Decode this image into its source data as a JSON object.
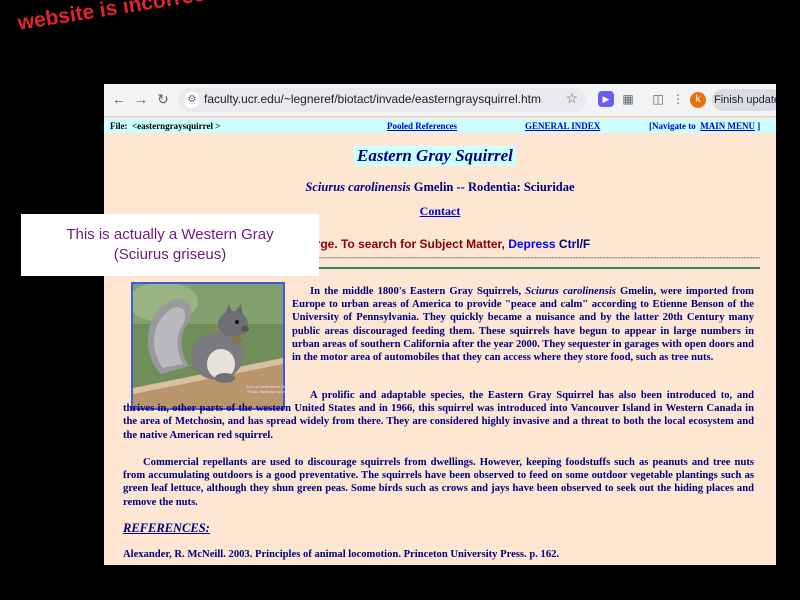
{
  "annotations": {
    "top_note": "website is incorrect",
    "overlay_line1": "This is actually a Western Gray",
    "overlay_line2": "(Sciurus griseus)"
  },
  "browser": {
    "url": "faculty.ucr.edu/~legneref/biotact/invade/easterngraysquirrel.htm",
    "profile_initial": "k",
    "update_button": "Finish update",
    "icons": [
      "back-arrow-icon",
      "forward-arrow-icon",
      "reload-icon",
      "site-settings-icon",
      "bookmark-star-icon",
      "extension-icon",
      "puzzle-icon",
      "tab-search-icon",
      "profile-avatar-icon"
    ]
  },
  "page": {
    "topbar": {
      "file_label": "File:",
      "file_name": "<easterngraysquirrel >",
      "pooled_refs": "Pooled References",
      "general_index": "GENERAL INDEX",
      "navigate_prefix": "[Navigate to",
      "main_menu": "MAIN MENU",
      "navigate_suffix": "]"
    },
    "title": "Eastern Gray Squirrel",
    "sci_name": "Sciurus carolinensis",
    "sci_rest": " Gmelin -- Rodentia:  Sciuridae",
    "contact": "Contact",
    "search_text": "arge.  To search for Subject Matter,",
    "search_depress": "Depress",
    "search_key": "Ctrl/F",
    "photo_caption": "Sciurus carolinensis Gmelin Photo: Rodentia Sciuridae",
    "para1_pre": "In the middle 1800's Eastern Gray Squirrels,",
    "para1_italic": "Sciurus carolinensis",
    "para1_post": "Gmelin, were imported from Europe to urban areas of America to provide \"peace and calm\" according to Etienne Benson of the University of Pennsylvania.  They quickly became a nuisance and by the latter 20th Century many public areas discouraged feeding them.  These squirrels have begun to appear in large numbers in urban areas of southern California after the year 2000.  They sequester in garages with open doors and in the motor area of automobiles that they can access where they store food, such as tree nuts.",
    "para2": "A prolific and adaptable species, the Eastern Gray Squirrel has also been introduced to, and thrives in, other parts of the western United States and in 1966, this squirrel was introduced into Vancouver Island in Western Canada in the area of Metchosin, and has spread widely from there.  They are considered highly invasive and a threat to both the local ecosystem and the native American red squirrel.",
    "para3": "Commercial repellants are used to discourage squirrels from dwellings.  However, keeping foodstuffs such as peanuts and tree nuts from accumulating outdoors is a good preventative.  The squirrels have been observed to feed on some outdoor vegetable plantings such as green leaf lettuce, although they shun green peas.  Some birds such as crows and jays have been observed to seek out the hiding places and remove the nuts.",
    "references_heading": "REFERENCES:",
    "reference1": "Alexander, R. McNeill.  2003.  Principles of animal locomotion.  Princeton University Press. p. 162."
  },
  "colors": {
    "page_bg": "#fde6d2",
    "title_bg": "#ccffff",
    "text_navy": "#000080",
    "link_blue": "#0000cc",
    "annotation_red": "#e0262b",
    "overlay_purple": "#6a1b7a"
  }
}
